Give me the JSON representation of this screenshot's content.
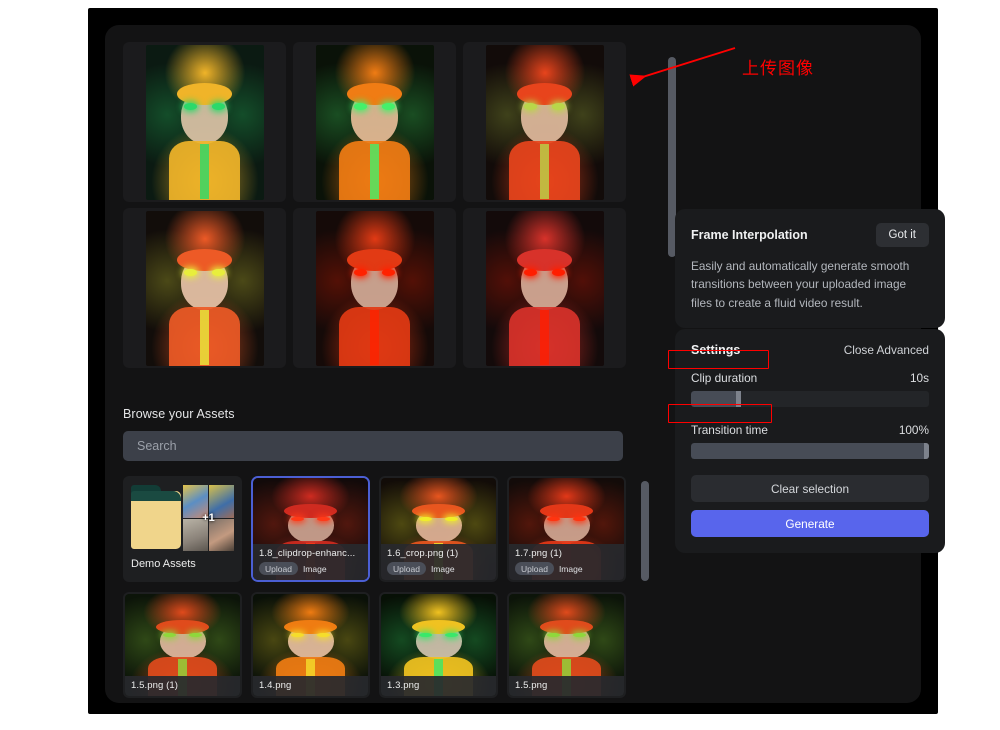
{
  "annotation": {
    "callout_text": "上传图像",
    "arrow_color": "#ff0000",
    "highlight_boxes": [
      "Clip duration",
      "Transition time"
    ]
  },
  "upload_grid": {
    "scroll_position": "top",
    "cards": [
      {
        "name": "uploaded-image-1",
        "palette": [
          "#0b1a12",
          "#f0b429",
          "#2bd96a",
          "#d7c0a3"
        ]
      },
      {
        "name": "uploaded-image-2",
        "palette": [
          "#0a1208",
          "#f07c14",
          "#45f06a",
          "#e0b894"
        ]
      },
      {
        "name": "uploaded-image-3",
        "palette": [
          "#120b09",
          "#e8441c",
          "#b9d64a",
          "#dbb69a"
        ]
      },
      {
        "name": "uploaded-image-4",
        "palette": [
          "#120d0a",
          "#ed5a26",
          "#e8ee3c",
          "#e3bfa4"
        ]
      },
      {
        "name": "uploaded-image-5",
        "palette": [
          "#150a08",
          "#e23a14",
          "#ff2200",
          "#cfa893"
        ]
      },
      {
        "name": "uploaded-image-6",
        "palette": [
          "#130a0a",
          "#d8322a",
          "#ff1e00",
          "#d2a894"
        ]
      }
    ]
  },
  "browse": {
    "label": "Browse your Assets",
    "search_placeholder": "Search",
    "search_value": ""
  },
  "assets": {
    "folder": {
      "label": "Demo Assets",
      "extra_count": "+1"
    },
    "items": [
      {
        "name": "1.8_clipdrop-enhanc...",
        "tag_source": "Upload",
        "tag_kind": "Image",
        "selected": true,
        "palette": [
          "#120a0a",
          "#cf2b20",
          "#ff3a18",
          "#c8a08e"
        ]
      },
      {
        "name": "1.6_crop.png (1)",
        "tag_source": "Upload",
        "tag_kind": "Image",
        "selected": false,
        "palette": [
          "#120c08",
          "#e8561f",
          "#f0ee2a",
          "#dcb095"
        ]
      },
      {
        "name": "1.7.png (1)",
        "tag_source": "Upload",
        "tag_kind": "Image",
        "selected": false,
        "palette": [
          "#130b09",
          "#e33818",
          "#ff3410",
          "#cfa38f"
        ]
      },
      {
        "name": "1.5.png (1)",
        "tag_source": "",
        "tag_kind": "",
        "selected": false,
        "palette": [
          "#0c1409",
          "#e04b1c",
          "#8fd83c",
          "#dcb49c"
        ]
      },
      {
        "name": "1.4.png",
        "tag_source": "",
        "tag_kind": "",
        "selected": false,
        "palette": [
          "#0a1008",
          "#ef7c12",
          "#f5dd2c",
          "#e1bb9c"
        ]
      },
      {
        "name": "1.3.png",
        "tag_source": "",
        "tag_kind": "",
        "selected": false,
        "palette": [
          "#071006",
          "#f0c221",
          "#39e86a",
          "#ccc0ab"
        ]
      },
      {
        "name": "1.5.png",
        "tag_source": "",
        "tag_kind": "",
        "selected": false,
        "palette": [
          "#0c1409",
          "#e04b1c",
          "#8fd83c",
          "#dcb49c"
        ]
      }
    ]
  },
  "info_card": {
    "title": "Frame Interpolation",
    "got_it_label": "Got it",
    "body": "Easily and automatically generate smooth transitions between your uploaded image files to create a fluid video result."
  },
  "settings": {
    "title": "Settings",
    "close_advanced_label": "Close Advanced",
    "clip_duration": {
      "label": "Clip duration",
      "value": "10s",
      "fill_percent": 20
    },
    "transition_time": {
      "label": "Transition time",
      "value": "100%",
      "fill_percent": 100
    },
    "clear_selection_label": "Clear selection",
    "generate_label": "Generate",
    "accent_color": "#5865ec"
  }
}
